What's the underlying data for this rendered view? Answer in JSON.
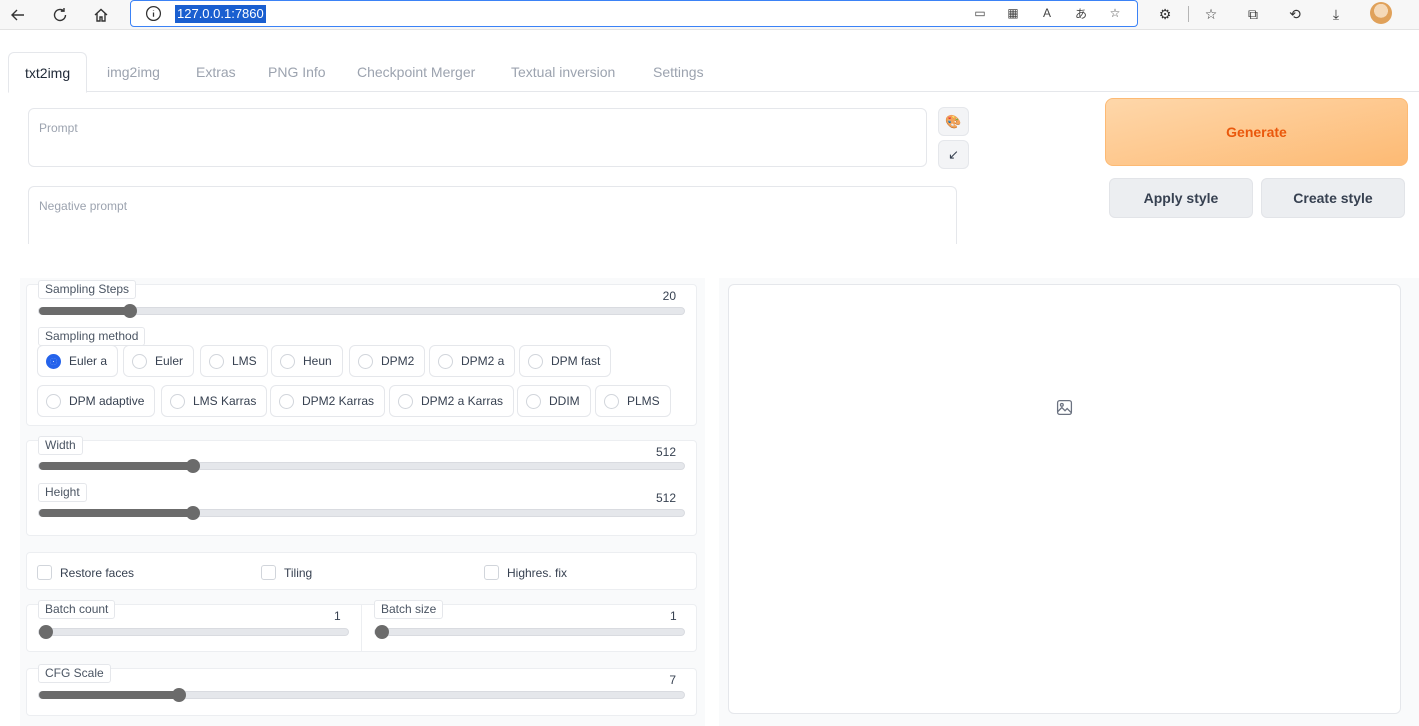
{
  "browser": {
    "url": "127.0.0.1:7860"
  },
  "tabs": [
    {
      "label": "txt2img",
      "active": true
    },
    {
      "label": "img2img"
    },
    {
      "label": "Extras"
    },
    {
      "label": "PNG Info"
    },
    {
      "label": "Checkpoint Merger"
    },
    {
      "label": "Textual inversion"
    },
    {
      "label": "Settings"
    }
  ],
  "prompt": {
    "placeholder": "Prompt"
  },
  "negative_prompt": {
    "placeholder": "Negative prompt"
  },
  "buttons": {
    "generate": "Generate",
    "apply_style": "Apply style",
    "create_style": "Create style",
    "paste_icon": "🎨",
    "arrow_icon": "↙"
  },
  "sampling_steps": {
    "label": "Sampling Steps",
    "value": "20",
    "fraction": 0.133
  },
  "sampling_method": {
    "label": "Sampling method",
    "selected": "Euler a",
    "options": [
      "Euler a",
      "Euler",
      "LMS",
      "Heun",
      "DPM2",
      "DPM2 a",
      "DPM fast",
      "DPM adaptive",
      "LMS Karras",
      "DPM2 Karras",
      "DPM2 a Karras",
      "DDIM",
      "PLMS"
    ]
  },
  "width": {
    "label": "Width",
    "value": "512",
    "fraction": 0.233
  },
  "height": {
    "label": "Height",
    "value": "512",
    "fraction": 0.233
  },
  "checkboxes": {
    "restore_faces": "Restore faces",
    "tiling": "Tiling",
    "highres_fix": "Highres. fix"
  },
  "batch_count": {
    "label": "Batch count",
    "value": "1",
    "fraction": 0.0
  },
  "batch_size": {
    "label": "Batch size",
    "value": "1",
    "fraction": 0.0
  },
  "cfg_scale": {
    "label": "CFG Scale",
    "value": "7",
    "fraction": 0.21
  }
}
